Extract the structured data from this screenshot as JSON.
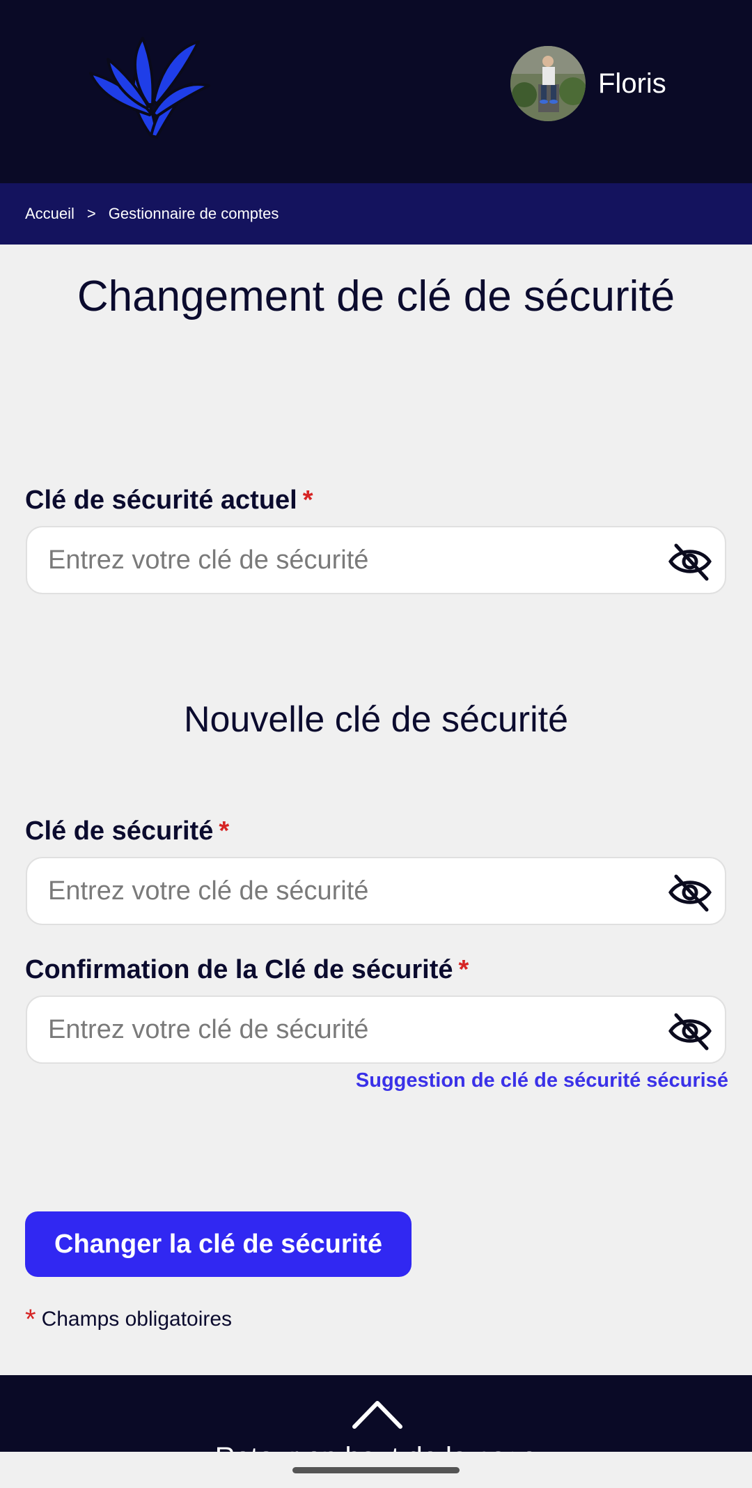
{
  "header": {
    "logo_icon": "lily-flower-icon",
    "user": {
      "name": "Floris",
      "avatar": "user-avatar-photo"
    }
  },
  "breadcrumb": {
    "items": [
      "Accueil",
      "Gestionnaire de comptes"
    ],
    "separator": ">"
  },
  "page": {
    "title": "Changement de clé de sécurité"
  },
  "current_key": {
    "label": "Clé de sécurité actuel",
    "required_mark": "*",
    "placeholder": "Entrez votre clé de sécurité",
    "value": "",
    "toggle_icon": "eye-slash-icon"
  },
  "new_section": {
    "title": "Nouvelle clé de sécurité"
  },
  "new_key": {
    "label": "Clé de sécurité",
    "required_mark": "*",
    "placeholder": "Entrez votre clé de sécurité",
    "value": "",
    "toggle_icon": "eye-slash-icon"
  },
  "confirm_key": {
    "label": "Confirmation de la Clé de sécurité",
    "required_mark": "*",
    "placeholder": "Entrez votre clé de sécurité",
    "value": "",
    "toggle_icon": "eye-slash-icon"
  },
  "suggestion_link": "Suggestion de clé de sécurité sécurisé",
  "submit_button": "Changer la clé de sécurité",
  "required_note": {
    "mark": "*",
    "text": "Champs obligatoires"
  },
  "footer": {
    "back_to_top_icon": "chevron-up-icon",
    "text": "Retour en haut de la page"
  },
  "colors": {
    "header_bg": "#0a0a26",
    "breadcrumb_bg": "#14135e",
    "page_bg": "#f0f0f0",
    "accent": "#3128f2",
    "link": "#3a31e8",
    "required": "#d62424",
    "logo": "#1f3ee8"
  }
}
